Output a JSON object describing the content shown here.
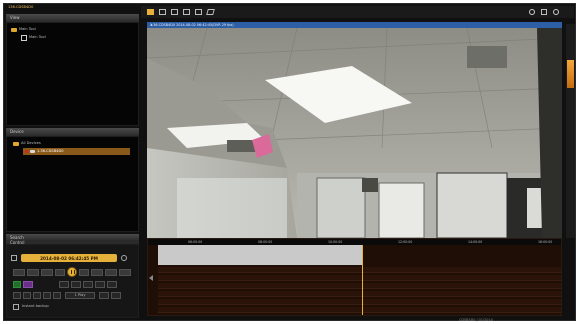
{
  "app": {
    "device_title": "136.CDSB4D0",
    "status_text": "CDSB4D0 / 01/2014"
  },
  "view_panel": {
    "title": "View",
    "items": [
      {
        "label": "Main Tool"
      },
      {
        "label": "Main Tool"
      }
    ]
  },
  "device_panel": {
    "title": "Device",
    "items": [
      {
        "label": "All Devices"
      },
      {
        "label": "1.36.CDSB4D0"
      }
    ]
  },
  "search_panel": {
    "title": "Search"
  },
  "control_panel": {
    "title": "Control",
    "datetime": "2014-08-02 06:42:45 PM",
    "speed": "1 Play",
    "instant_backup_label": "Instant backup"
  },
  "video": {
    "title": "1.36.CDSB4D0    2014-08-02 06:42:45(DVR 29 fps)",
    "close_glyph": "×"
  },
  "timeline": {
    "times": [
      "06:00:00",
      "08:00:00",
      "10:00:00",
      "12:00:00",
      "14:00:00",
      "16:00:00"
    ]
  },
  "colors": {
    "accent": "#e6b13a",
    "title_bar": "#2d5fa6",
    "timeline_bg": "#1e0e06"
  }
}
